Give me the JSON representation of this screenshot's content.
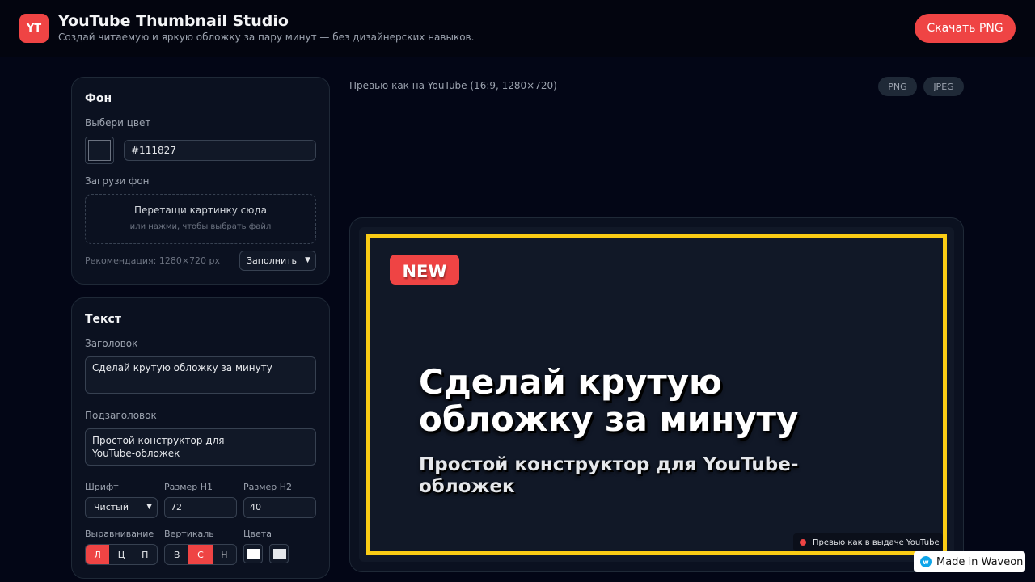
{
  "header": {
    "logo": "YT",
    "title": "YouTube Thumbnail Studio",
    "subtitle": "Создай читаемую и яркую обложку за пару минут — без дизайнерских навыков.",
    "download_label": "Скачать PNG"
  },
  "background_panel": {
    "title": "Фон",
    "color_label": "Выбери цвет",
    "color_value": "#111827",
    "upload_label": "Загрузи фон",
    "dropzone_main": "Перетащи картинку сюда",
    "dropzone_sub": "или нажми, чтобы выбрать файл",
    "recommendation": "Рекомендация: 1280×720 px",
    "fit_select": "Заполнить"
  },
  "text_panel": {
    "title": "Текст",
    "heading_label": "Заголовок",
    "heading_value": "Сделай крутую обложку за минуту",
    "subheading_label": "Подзаголовок",
    "subheading_value": "Простой конструктор для\nYouTube-обложек",
    "font_label": "Шрифт",
    "font_value": "Чистый",
    "h1_size_label": "Размер H1",
    "h1_size_value": "72",
    "h2_size_label": "Размер H2",
    "h2_size_value": "40",
    "align_label": "Выравнивание",
    "align_options": [
      "Л",
      "Ц",
      "П"
    ],
    "vertical_label": "Вертикаль",
    "vertical_options": [
      "В",
      "С",
      "Н"
    ],
    "colors_label": "Цвета",
    "color_1": "#ffffff",
    "color_2": "#e5e7eb"
  },
  "preview": {
    "label": "Превью как на YouTube (16:9, 1280×720)",
    "formats": [
      "PNG",
      "JPEG"
    ],
    "badge": "NEW",
    "heading": "Сделай крутую обложку за минуту",
    "subheading": "Простой конструктор для YouTube-обложек",
    "hint": "Превью как в выдаче YouTube"
  },
  "waveon": {
    "label": "Made in Waveon"
  },
  "colors": {
    "accent": "#ef4444",
    "frame": "#facc15",
    "canvas_bg": "#111827"
  }
}
